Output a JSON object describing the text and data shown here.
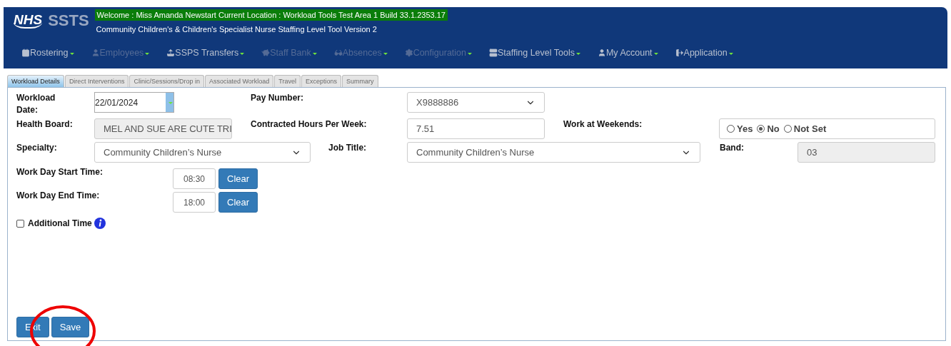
{
  "header": {
    "logo": "NHS",
    "product": "SSTS",
    "welcome": "Welcome : Miss Amanda Newstart Current Location : Workload Tools Test Area 1 Build 33.1.2353.17",
    "subtitle": "Community Children's & Children's Specialist Nurse Staffing Level Tool Version 2"
  },
  "menu": [
    {
      "label": "Rostering",
      "disabled": false
    },
    {
      "label": "Employees",
      "disabled": true
    },
    {
      "label": "SSPS Transfers",
      "disabled": false
    },
    {
      "label": "Staff Bank",
      "disabled": true
    },
    {
      "label": "Absences",
      "disabled": true
    },
    {
      "label": "Configuration",
      "disabled": true
    },
    {
      "label": "Staffing Level Tools",
      "disabled": false
    },
    {
      "label": "My Account",
      "disabled": false
    },
    {
      "label": "Application",
      "disabled": false
    }
  ],
  "tabs": [
    {
      "label": "Workload Details",
      "selected": true
    },
    {
      "label": "Direct Interventions",
      "selected": false
    },
    {
      "label": "Clinic/Sessions/Drop in",
      "selected": false
    },
    {
      "label": "Associated Workload",
      "selected": false
    },
    {
      "label": "Travel",
      "selected": false
    },
    {
      "label": "Exceptions",
      "selected": false
    },
    {
      "label": "Summary",
      "selected": false
    }
  ],
  "form": {
    "workload_date": {
      "label": "Workload Date:",
      "value": "22/01/2024"
    },
    "pay_number": {
      "label": "Pay Number:",
      "value": "X9888886"
    },
    "health_board": {
      "label": "Health Board:",
      "value": "MEL AND SUE ARE CUTE TRI",
      "disabled": true
    },
    "contracted_hours": {
      "label": "Contracted Hours Per Week:",
      "value": "7.51"
    },
    "work_at_weekends": {
      "label": "Work at Weekends:",
      "options": [
        {
          "label": "Yes",
          "selected": false
        },
        {
          "label": "No",
          "selected": true
        },
        {
          "label": "Not Set",
          "selected": false
        }
      ]
    },
    "specialty": {
      "label": "Specialty:",
      "value": "Community Children’s Nurse"
    },
    "job_title": {
      "label": "Job Title:",
      "value": "Community Children’s Nurse"
    },
    "band": {
      "label": "Band:",
      "value": "03",
      "disabled": true
    },
    "start_time": {
      "label": "Work Day Start Time:",
      "value": "08:30",
      "button": "Clear"
    },
    "end_time": {
      "label": "Work Day End Time:",
      "value": "18:00",
      "button": "Clear"
    },
    "additional_time": {
      "label": "Additional Time",
      "checked": false
    }
  },
  "buttons": [
    "Exit",
    "Save"
  ]
}
